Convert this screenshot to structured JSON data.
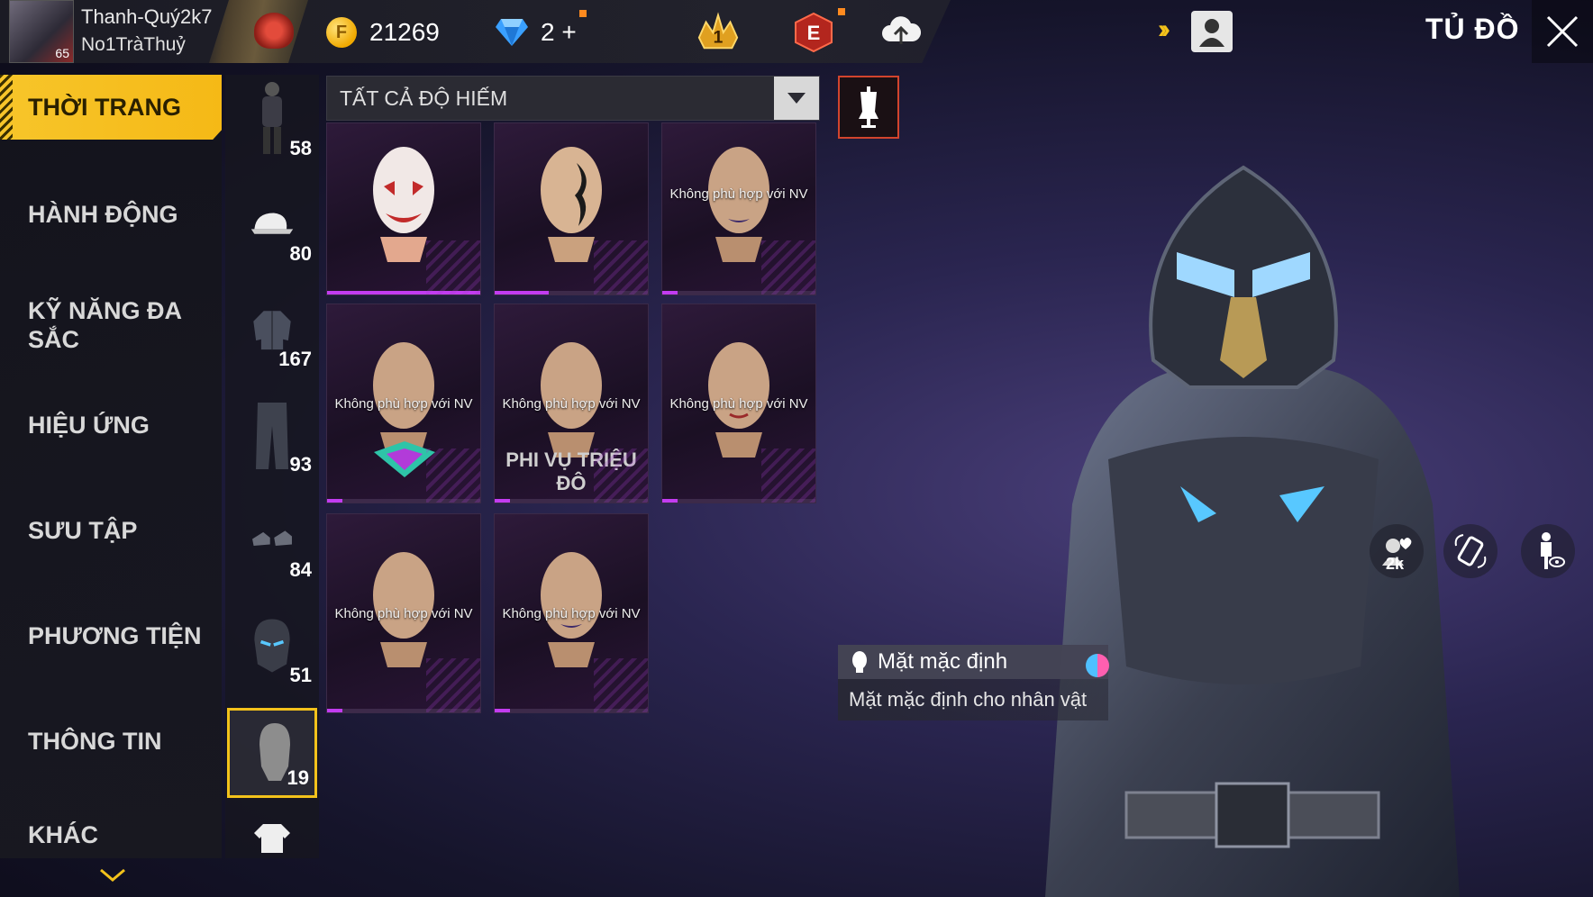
{
  "player": {
    "name": "Thanh-Quý2k7",
    "guild": "No1TràThuỷ",
    "level": "65"
  },
  "currency": {
    "gold": "21269",
    "diamonds": "2",
    "diamonds_add": "+"
  },
  "header": {
    "title": "TỦ ĐỒ",
    "icons": [
      "rank-crown-icon",
      "elite-pass-icon",
      "cloud-upload-icon",
      "double-arrow-icon",
      "profile-card-icon",
      "close-icon"
    ]
  },
  "menu": {
    "items": [
      {
        "label": "THỜI TRANG",
        "active": true
      },
      {
        "label": "HÀNH ĐỘNG",
        "active": false
      },
      {
        "label": "KỸ NĂNG ĐA SẮC",
        "active": false
      },
      {
        "label": "HIỆU ỨNG",
        "active": false
      },
      {
        "label": "SƯU TẬP",
        "active": false
      },
      {
        "label": "PHƯƠNG TIỆN",
        "active": false
      },
      {
        "label": "THÔNG TIN",
        "active": false
      },
      {
        "label": "KHÁC",
        "active": false
      }
    ]
  },
  "subcategories": [
    {
      "icon": "full-outfit-icon",
      "count": "58"
    },
    {
      "icon": "cap-icon",
      "count": "80"
    },
    {
      "icon": "jacket-icon",
      "count": "167"
    },
    {
      "icon": "pants-icon",
      "count": "93"
    },
    {
      "icon": "shoes-icon",
      "count": "84"
    },
    {
      "icon": "helmet-mask-icon",
      "count": "51"
    },
    {
      "icon": "face-mask-icon",
      "count": "19",
      "selected": true
    },
    {
      "icon": "shirt-icon",
      "count": ""
    }
  ],
  "filter": {
    "value": "TẤT CẢ ĐỘ HIẾM"
  },
  "items": [
    {
      "style": "joker",
      "note": "",
      "brand": "",
      "rarity": 1.0
    },
    {
      "style": "tattoo",
      "note": "",
      "brand": "",
      "rarity": 0.35
    },
    {
      "style": "plain",
      "note": "Không phù hợp với NV",
      "brand": "",
      "rarity": 0.1
    },
    {
      "style": "emblem",
      "note": "Không phù hợp với NV",
      "brand": "",
      "rarity": 0.1
    },
    {
      "style": "plain",
      "note": "Không phù hợp với NV",
      "brand": "PHI VỤ TRIỆU ĐÔ",
      "rarity": 0.1
    },
    {
      "style": "plain",
      "note": "Không phù hợp với NV",
      "brand": "",
      "rarity": 0.1
    },
    {
      "style": "plain",
      "note": "Không phù hợp với NV",
      "brand": "",
      "rarity": 0.1
    },
    {
      "style": "plain",
      "note": "Không phù hợp với NV",
      "brand": "",
      "rarity": 0.1
    }
  ],
  "selected_item": {
    "title": "Mặt mặc định",
    "description": "Mặt mặc định cho nhân vật"
  },
  "side_actions": {
    "like_count": "2k",
    "icons": [
      "heart-like-icon",
      "rotate-icon",
      "pose-view-icon"
    ]
  },
  "colors": {
    "accent": "#F5BE1E",
    "rarity": "#C23CF0",
    "danger": "#D2442D"
  }
}
